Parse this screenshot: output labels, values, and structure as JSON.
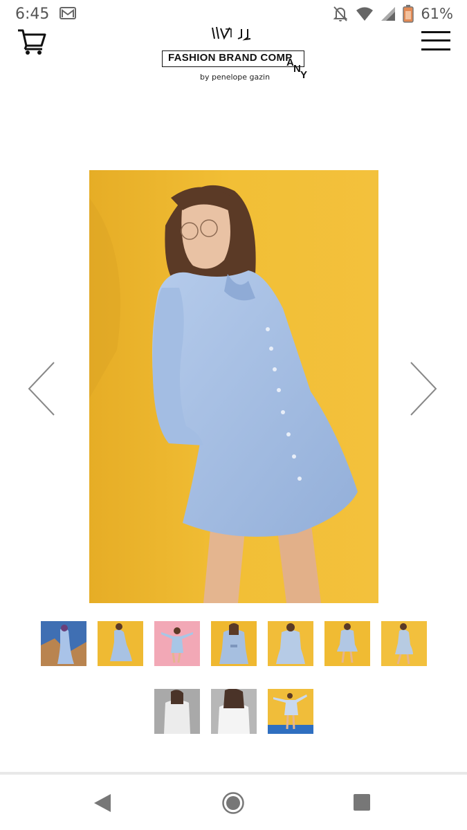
{
  "status_bar": {
    "time": "6:45",
    "battery_percent": "61%",
    "icons": [
      "gmail-icon",
      "notifications-off-icon",
      "wifi-icon",
      "cell-signal-icon",
      "battery-icon"
    ]
  },
  "header": {
    "brand_name": "FASHION BRAND COMP",
    "brand_tail": [
      "A",
      "N",
      "Y"
    ],
    "brand_byline": "by penelope gazin",
    "left_icon": "cart-icon",
    "right_icon": "menu-icon"
  },
  "gallery": {
    "main_image": "model-in-blue-shirt-dress-yellow-background",
    "prev_icon": "chevron-left-icon",
    "next_icon": "chevron-right-icon",
    "thumbnails_row1": [
      {
        "bg": "#b9844f",
        "sky": "#3f6fb3",
        "dress": "#a9c3e8"
      },
      {
        "bg": "#efba33",
        "dress": "#a8c2e3"
      },
      {
        "bg": "#f2a8b6",
        "dress": "#a8c6e6"
      },
      {
        "bg": "#efb830",
        "dress": "#a6bfe0"
      },
      {
        "bg": "#f1bd39",
        "dress": "#b6cbe6"
      },
      {
        "bg": "#f0bb33",
        "dress": "#b1c7e4"
      },
      {
        "bg": "#f2c03d",
        "dress": "#b7cbe2"
      }
    ],
    "thumbnails_row2": [
      {
        "bg": "#a9a9a9",
        "dress": "#ececec"
      },
      {
        "bg": "#b7b7b7",
        "dress": "#f4f4f4"
      },
      {
        "bg": "#f0bd3a",
        "dress": "#c9d9ef",
        "sea": "#2f6fc0"
      }
    ]
  },
  "nav_bar": {
    "icons": [
      "back-icon",
      "home-icon",
      "recent-apps-icon"
    ]
  },
  "colors": {
    "photo_background": "#f0b92c",
    "dress": "#a9c2e6",
    "icon_gray": "#777777"
  }
}
